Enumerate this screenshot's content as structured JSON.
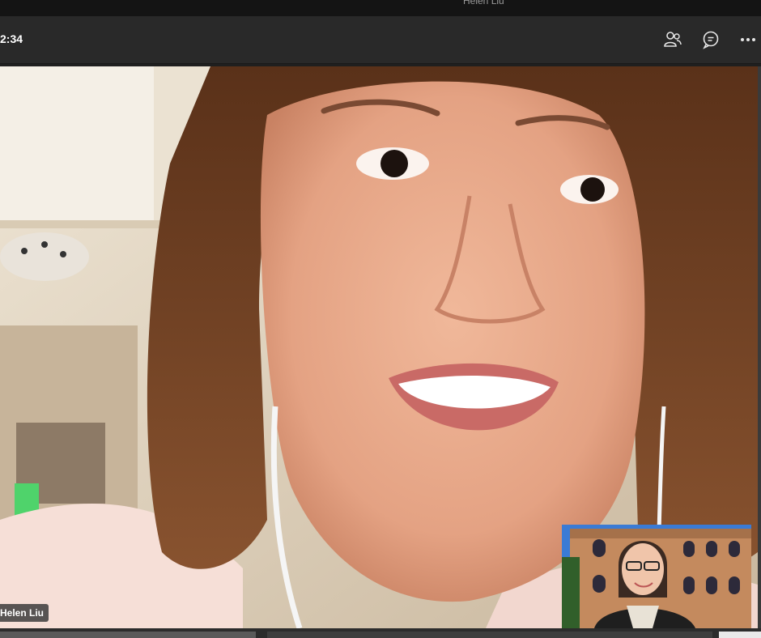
{
  "window": {
    "title": "Helen Liu"
  },
  "toolbar": {
    "timer": "2:34",
    "participants_icon": "people-icon",
    "chat_icon": "chat-icon",
    "more_icon": "more-options-icon"
  },
  "main_video": {
    "participant_name": "Helen Liu"
  },
  "self_view": {
    "background_scene": "colosseum"
  }
}
